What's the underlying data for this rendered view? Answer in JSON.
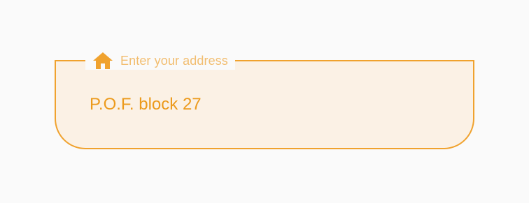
{
  "address_field": {
    "label": "Enter your address",
    "value": "P.O.F. block 27",
    "icon": "home-icon"
  },
  "colors": {
    "background": "#fafafa",
    "field_fill": "#fbf1e5",
    "accent": "#f0a22e",
    "label": "#f2bd6f",
    "value_text": "#ec9a1c"
  }
}
